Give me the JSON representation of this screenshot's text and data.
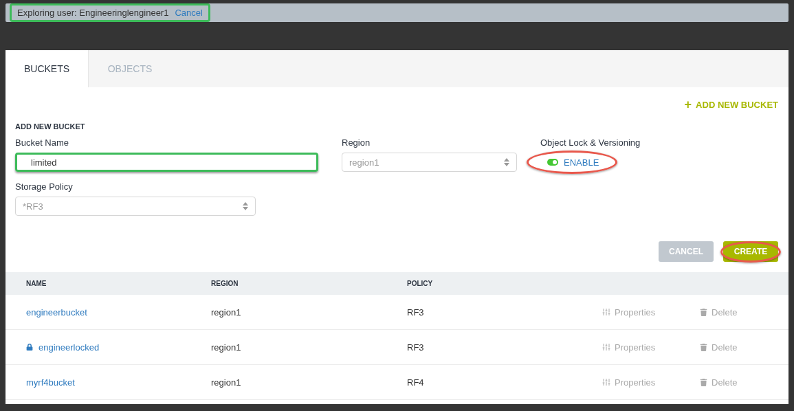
{
  "banner": {
    "text": "Exploring user: Engineeringlengineer1",
    "cancel": "Cancel",
    "highlighted": true
  },
  "tabs": [
    {
      "label": "BUCKETS",
      "selected": true
    },
    {
      "label": "OBJECTS",
      "selected": false
    }
  ],
  "add_link": {
    "icon": "+",
    "label": "ADD NEW BUCKET"
  },
  "form": {
    "title": "ADD NEW BUCKET",
    "bucket_name": {
      "label": "Bucket Name",
      "value": "limited",
      "highlighted": true
    },
    "region": {
      "label": "Region",
      "value": "region1"
    },
    "object_lock": {
      "label": "Object Lock & Versioning",
      "toggle_label": "ENABLE",
      "on": true,
      "highlighted": true
    },
    "storage_policy": {
      "label": "Storage Policy",
      "value": "*RF3"
    },
    "buttons": [
      {
        "label": "CANCEL",
        "kind": "secondary",
        "highlighted": false
      },
      {
        "label": "CREATE",
        "kind": "primary",
        "highlighted": true
      }
    ]
  },
  "table": {
    "columns": [
      "NAME",
      "REGION",
      "POLICY"
    ],
    "rows": [
      {
        "name": "engineerbucket",
        "locked": false,
        "region": "region1",
        "policy": "RF3",
        "properties": "Properties",
        "delete": "Delete"
      },
      {
        "name": "engineerlocked",
        "locked": true,
        "region": "region1",
        "policy": "RF3",
        "properties": "Properties",
        "delete": "Delete"
      },
      {
        "name": "myrf4bucket",
        "locked": false,
        "region": "region1",
        "policy": "RF4",
        "properties": "Properties",
        "delete": "Delete"
      }
    ]
  }
}
